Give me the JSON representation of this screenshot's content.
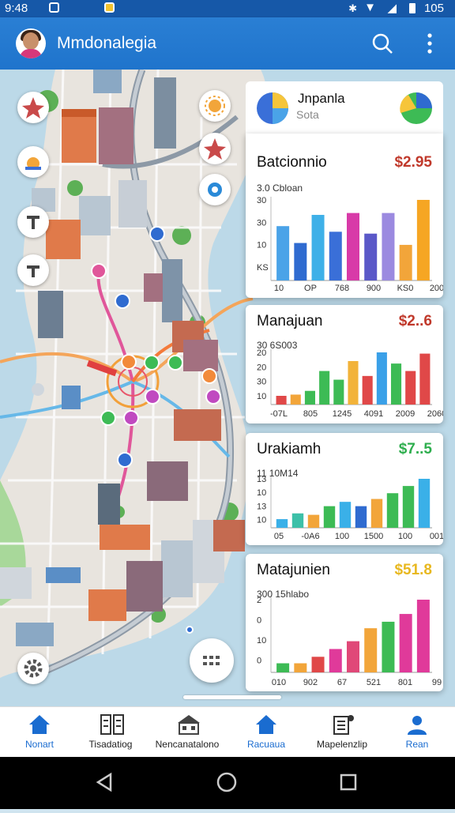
{
  "status": {
    "time": "9:48",
    "battery": "105"
  },
  "app": {
    "title": "Mmdonalegia"
  },
  "legend": {
    "title": "Jnpanla",
    "subtitle": "Sota"
  },
  "cards": [
    {
      "title": "Batcionnio",
      "price": "$2.95",
      "price_color": "#c0392b",
      "sub": "3.0 Cbloan",
      "yticks": [
        "30",
        "30",
        "10",
        "KS"
      ],
      "xticks": [
        "10",
        "OP",
        "768",
        "900",
        "KS0",
        "200"
      ],
      "values": [
        58,
        40,
        70,
        52,
        72,
        50,
        72,
        38,
        86
      ],
      "colors": [
        "#4aa3e8",
        "#2f6bd0",
        "#3eb0e8",
        "#3a6fd8",
        "#d83aa8",
        "#5a58c8",
        "#9b8ae0",
        "#f2a53a",
        "#f6a623"
      ]
    },
    {
      "title": "Manajuan",
      "price": "$2..6",
      "price_color": "#c0392b",
      "sub": "30 6S003",
      "yticks": [
        "20",
        "20",
        "30",
        "10"
      ],
      "xticks": [
        "-07L",
        "805",
        "1245",
        "4091",
        "2009",
        "2060"
      ],
      "values": [
        14,
        16,
        22,
        54,
        40,
        70,
        46,
        84,
        66,
        54,
        82
      ],
      "colors": [
        "#e04848",
        "#f2a53a",
        "#3dbb55",
        "#3dbb55",
        "#3dbb55",
        "#f2b33a",
        "#e04848",
        "#3aa0e8",
        "#3dbb55",
        "#e04848",
        "#e04848"
      ]
    },
    {
      "title": "Urakiamh",
      "price": "$7..5",
      "price_color": "#2eae4e",
      "sub": "11 10M14",
      "yticks": [
        "13",
        "10",
        "13",
        "10"
      ],
      "xticks": [
        "05",
        "-0A6",
        "100",
        "1500",
        "100",
        "001"
      ],
      "values": [
        12,
        20,
        18,
        30,
        36,
        30,
        40,
        48,
        58,
        68
      ],
      "colors": [
        "#3ab0e8",
        "#3dc0a8",
        "#f2a53a",
        "#3dbb55",
        "#3ab0e8",
        "#2f6bd0",
        "#f2a53a",
        "#3dbb55",
        "#3dbb55",
        "#3ab0e8"
      ]
    },
    {
      "title": "Matajunien",
      "price": "$51.8",
      "price_color": "#e8b820",
      "sub": "300 15hlabo",
      "yticks": [
        "2",
        "0",
        "10",
        "0"
      ],
      "xticks": [
        "010",
        "902",
        "67",
        "521",
        "801",
        "99"
      ],
      "values": [
        14,
        14,
        24,
        36,
        48,
        68,
        78,
        90,
        112
      ],
      "colors": [
        "#3dbb55",
        "#f2a53a",
        "#e04848",
        "#e03a9a",
        "#e04878",
        "#f2a53a",
        "#3dbb55",
        "#e03a9a",
        "#e03a9a"
      ]
    }
  ],
  "nav": [
    {
      "label": "Nonart",
      "icon": "home-icon",
      "active": true
    },
    {
      "label": "Tisadatiog",
      "icon": "list-icon",
      "active": false
    },
    {
      "label": "Nencanatalono",
      "icon": "store-icon",
      "active": false
    },
    {
      "label": "Racuaua",
      "icon": "home-icon",
      "active": true
    },
    {
      "label": "Mapelenzlip",
      "icon": "report-icon",
      "active": false
    },
    {
      "label": "Rean",
      "icon": "person-icon",
      "active": true
    }
  ],
  "colors": {
    "appbar": "#1f74cc",
    "accent": "#1a6cd0",
    "water": "#bcd9e8"
  }
}
